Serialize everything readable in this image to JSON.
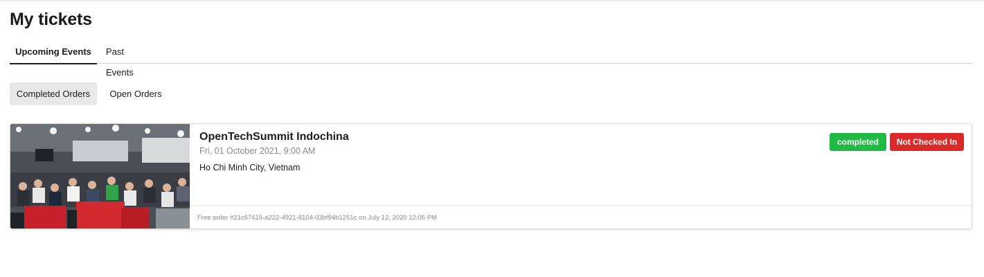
{
  "page": {
    "title": "My tickets"
  },
  "tabs": [
    {
      "label": "Upcoming Events",
      "active": true
    },
    {
      "label": "Past Events",
      "active": false
    }
  ],
  "order_filters": [
    {
      "label": "Completed Orders",
      "active": true
    },
    {
      "label": "Open Orders",
      "active": false
    }
  ],
  "ticket": {
    "image_icon": "event-photo",
    "title": "OpenTechSummit Indochina",
    "date": "Fri, 01 October 2021, 9:00 AM",
    "location": "Ho Chi Minh City, Vietnam",
    "status_badge": "completed",
    "checkin_badge": "Not Checked In",
    "order_info": "Free order #21c67415-a222-4921-8104-03bf94b1251c on July 12, 2020 12:05 PM"
  },
  "colors": {
    "completed": "#21ba45",
    "not_checked_in": "#db2828",
    "active_filter_bg": "#e8e8e8"
  }
}
